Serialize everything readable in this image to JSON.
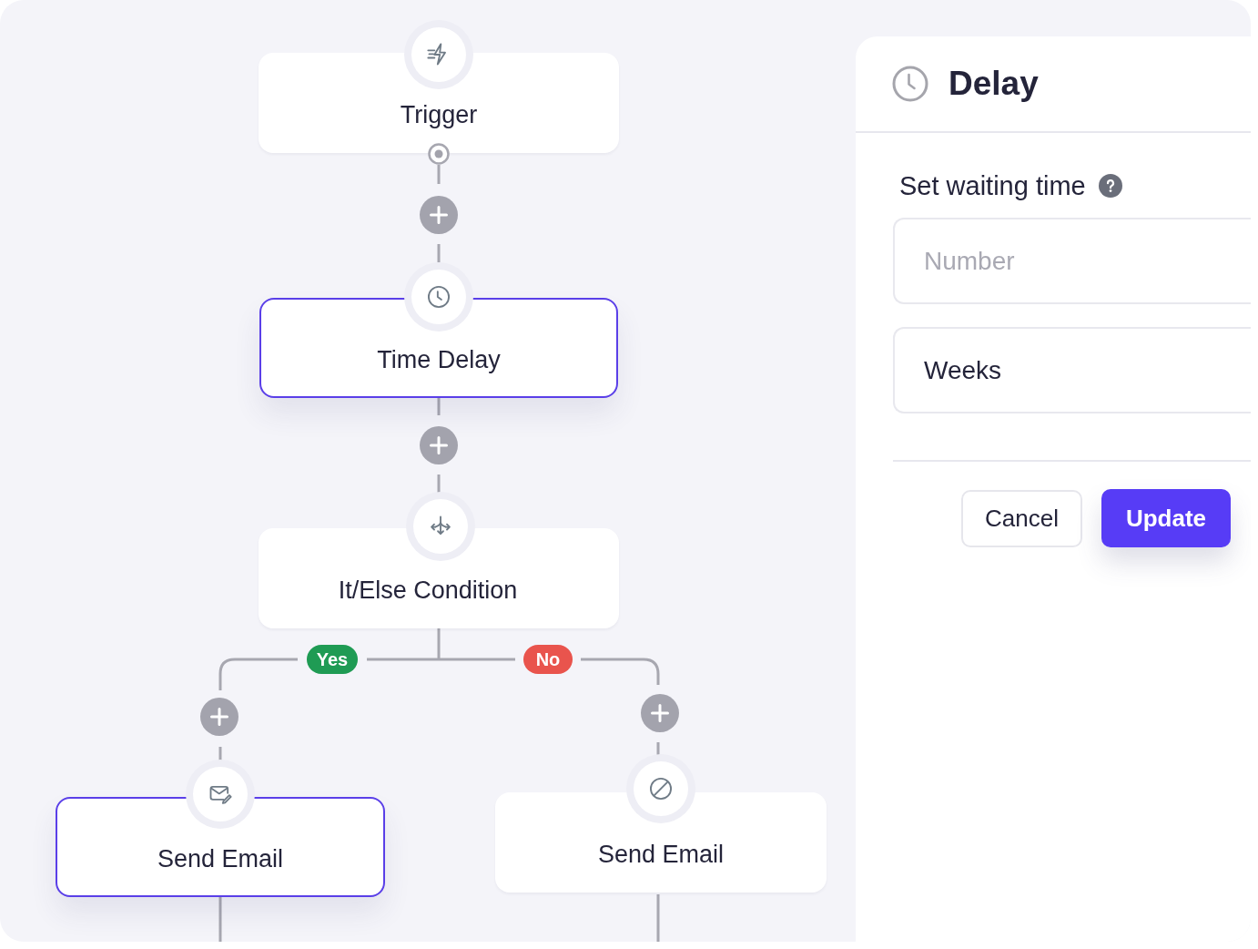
{
  "flow": {
    "steps": [
      {
        "kind": "trigger",
        "label": "Trigger",
        "selected": false
      },
      {
        "kind": "delay",
        "label": "Time Delay",
        "selected": true
      },
      {
        "kind": "condition",
        "label": "It/Else Condition",
        "selected": false
      }
    ],
    "branches": [
      {
        "label": "Yes",
        "color": "#1f9b54",
        "steps": [
          {
            "kind": "email",
            "label": "Send Email",
            "selected": true
          }
        ]
      },
      {
        "label": "No",
        "color": "#e9544d",
        "steps": [
          {
            "kind": "blocked",
            "label": "Send Email",
            "selected": false
          }
        ]
      }
    ]
  },
  "panel": {
    "title": "Delay",
    "field_label": "Set waiting time",
    "number_field": {
      "placeholder": "Number"
    },
    "unit_select": {
      "value": "Weeks"
    },
    "buttons": [
      {
        "label": "Cancel",
        "kind": "secondary"
      },
      {
        "label": "Update",
        "kind": "primary"
      }
    ]
  }
}
